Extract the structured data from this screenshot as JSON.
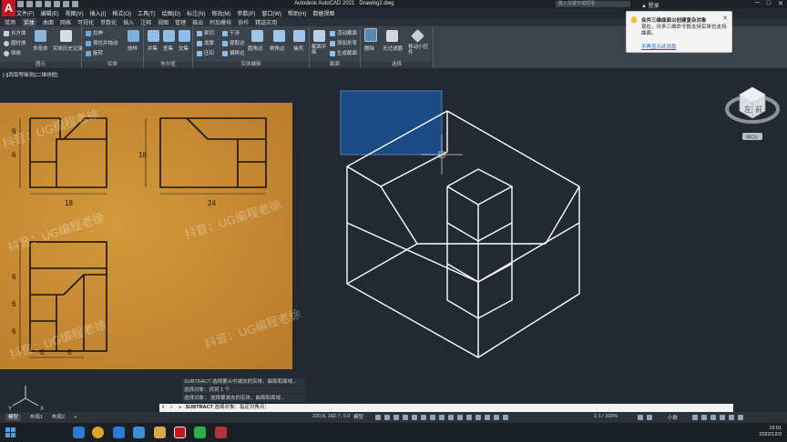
{
  "app": {
    "title": "Autodesk AutoCAD 2021",
    "drawing": "Drawing2.dwg",
    "search_placeholder": "键入关键字或短语",
    "login": "登录"
  },
  "menu": [
    "文件(F)",
    "编辑(E)",
    "视图(V)",
    "插入(I)",
    "格式(O)",
    "工具(T)",
    "绘图(D)",
    "标注(N)",
    "修改(M)",
    "参数(P)",
    "窗口(W)",
    "帮助(H)",
    "数据视图"
  ],
  "ribbon_tabs": [
    "常用",
    "实体",
    "曲面",
    "网格",
    "可视化",
    "参数化",
    "插入",
    "注释",
    "视图",
    "管理",
    "输出",
    "附加模块",
    "协作",
    "精选应用"
  ],
  "ribbon_active_tab": "实体",
  "ribbon": {
    "primitive": {
      "title": "图元",
      "items": [
        "长方体",
        "圆柱体",
        "球体"
      ],
      "big": [
        "多段体"
      ]
    },
    "solid_history": {
      "label": "实体历史记录"
    },
    "solid": {
      "title": "实体",
      "items": [
        "拉伸",
        "放样",
        "扫掠",
        "按住并拖动",
        "旋转"
      ]
    },
    "boolean": {
      "title": "布尔值",
      "items": [
        "并集",
        "差集",
        "交集"
      ]
    },
    "solid_edit": {
      "title": "实体编辑",
      "items": [
        "剖切",
        "加厚",
        "压印",
        "干涉",
        "提取边",
        "偏移边",
        "圆角边",
        "倒角边",
        "抽壳"
      ]
    },
    "section": {
      "title": "截面",
      "items": [
        "截面平面",
        "活动截面",
        "添加折弯",
        "生成截面"
      ]
    },
    "select": {
      "title": "选择",
      "items": [
        "删除",
        "无过滤器",
        "移动小控件"
      ]
    }
  },
  "notification": {
    "title": "合并三维曲面以创建复杂对象",
    "body": "现在，许多三维命令既支持实体也支持曲面。",
    "link": "不再显示此消息"
  },
  "viewport_label": "[-][西南等轴测][二维线框]",
  "reference": {
    "dims": [
      "6",
      "6",
      "18",
      "18",
      "24",
      "6",
      "6",
      "6",
      "6",
      "6"
    ],
    "watermark": "抖音：UG编程老徐"
  },
  "viewcube": {
    "face": "上",
    "left": "左",
    "front": "前",
    "wcs": "WCS"
  },
  "command": {
    "history": [
      "SUBTRACT 选择要从中减去的实体、曲面和面域...",
      "选择对象：找到 1 个",
      "选择对象：  选择要减去的实体、曲面和面域..."
    ],
    "prompt_cmd": "SUBTRACT",
    "prompt_text": "选择对象：指定对角点："
  },
  "status": {
    "tabs": [
      "模型",
      "布局1",
      "布局2"
    ],
    "active_tab": "模型",
    "coords": "220.8, 182.7, 0.0",
    "model": "模型",
    "scale": "1:1 / 100%",
    "units": "小数"
  },
  "taskbar": {
    "time": "19:01",
    "date": "2022/12/3"
  },
  "colors": {
    "accent": "#1a5fd1",
    "selection": "#1f4f8f",
    "autocad_red": "#c8141e"
  }
}
